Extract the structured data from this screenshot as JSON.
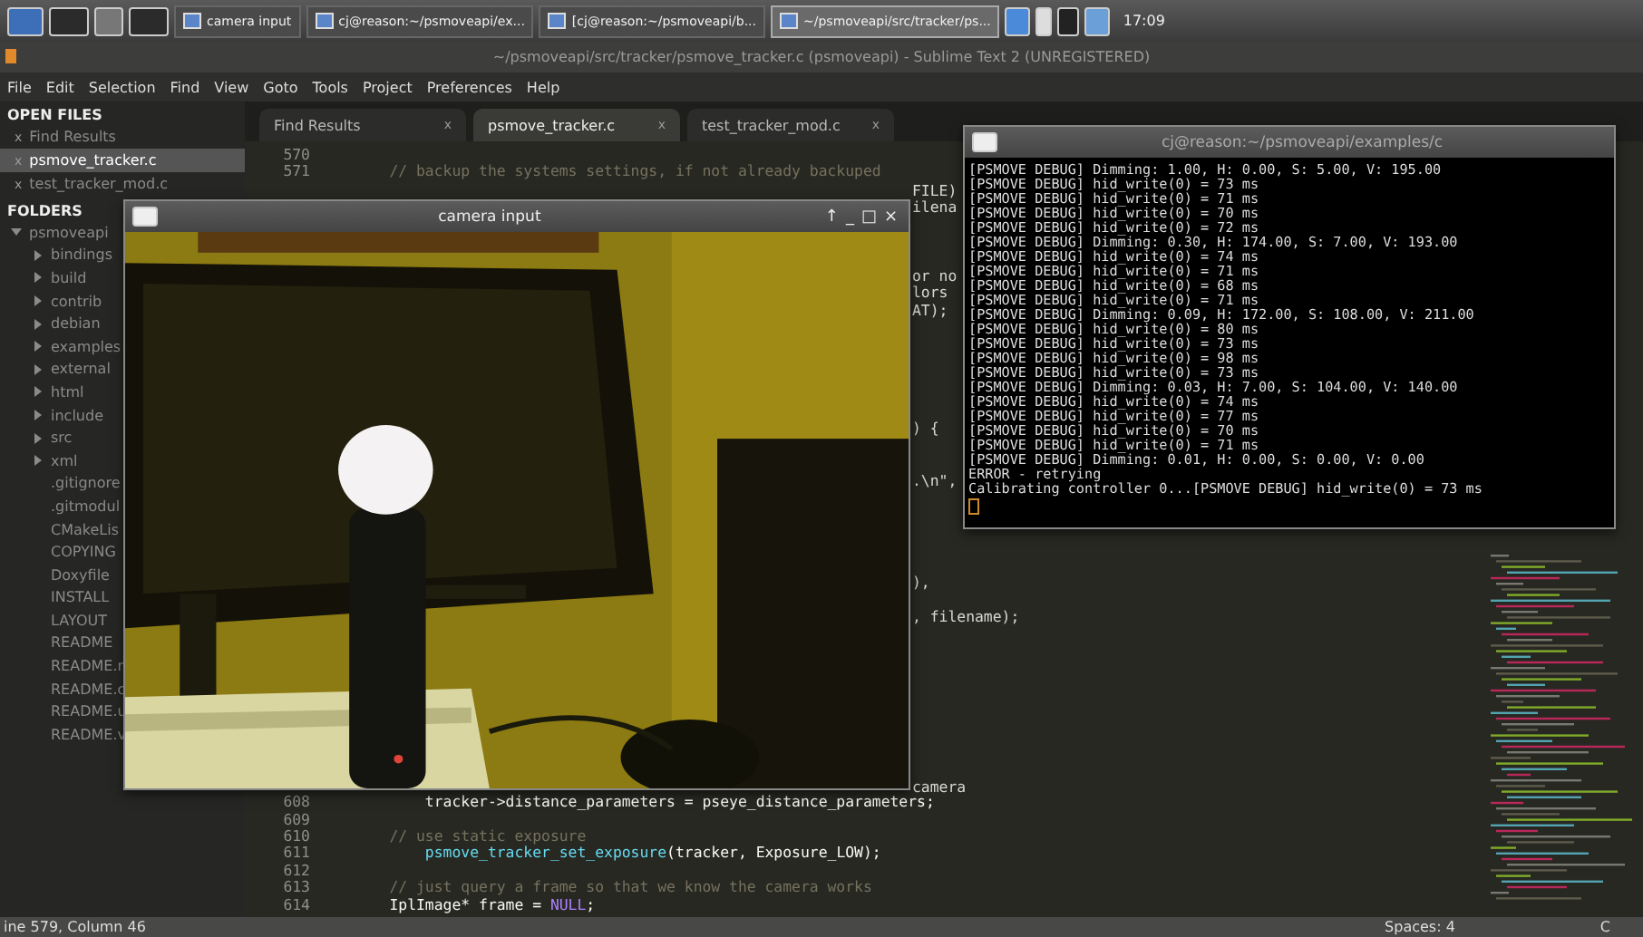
{
  "taskbar": {
    "tasks": [
      {
        "label": "camera input",
        "selected": false
      },
      {
        "label": "cj@reason:~/psmoveapi/ex...",
        "selected": false
      },
      {
        "label": "[cj@reason:~/psmoveapi/b...",
        "selected": false
      },
      {
        "label": "~/psmoveapi/src/tracker/ps...",
        "selected": true
      }
    ],
    "clock": "17:09"
  },
  "window": {
    "title": "~/psmoveapi/src/tracker/psmove_tracker.c (psmoveapi) - Sublime Text 2 (UNREGISTERED)"
  },
  "menu": [
    "File",
    "Edit",
    "Selection",
    "Find",
    "View",
    "Goto",
    "Tools",
    "Project",
    "Preferences",
    "Help"
  ],
  "sidebar": {
    "open_files_heading": "OPEN FILES",
    "open_files": [
      {
        "label": "Find Results",
        "close": "x",
        "selected": false
      },
      {
        "label": "psmove_tracker.c",
        "close": "x",
        "selected": true
      },
      {
        "label": "test_tracker_mod.c",
        "close": "x",
        "selected": false
      }
    ],
    "folders_heading": "FOLDERS",
    "folders": [
      {
        "label": "psmoveapi",
        "kind": "folder",
        "expanded": true,
        "children": [
          {
            "label": "bindings",
            "kind": "folder",
            "expanded": false
          },
          {
            "label": "build",
            "kind": "folder",
            "expanded": false
          },
          {
            "label": "contrib",
            "kind": "folder",
            "expanded": false
          },
          {
            "label": "debian",
            "kind": "folder",
            "expanded": false
          },
          {
            "label": "examples",
            "kind": "folder",
            "expanded": false
          },
          {
            "label": "external",
            "kind": "folder",
            "expanded": false
          },
          {
            "label": "html",
            "kind": "folder",
            "expanded": false
          },
          {
            "label": "include",
            "kind": "folder",
            "expanded": false
          },
          {
            "label": "src",
            "kind": "folder",
            "expanded": false
          },
          {
            "label": "xml",
            "kind": "folder",
            "expanded": false
          },
          {
            "label": ".gitignore",
            "kind": "file"
          },
          {
            "label": ".gitmodul",
            "kind": "file"
          },
          {
            "label": "CMakeLis",
            "kind": "file"
          },
          {
            "label": "COPYING",
            "kind": "file"
          },
          {
            "label": "Doxyfile",
            "kind": "file"
          },
          {
            "label": "INSTALL",
            "kind": "file"
          },
          {
            "label": "LAYOUT",
            "kind": "file"
          },
          {
            "label": "README",
            "kind": "file"
          },
          {
            "label": "README.r",
            "kind": "file"
          },
          {
            "label": "README.c",
            "kind": "file"
          },
          {
            "label": "README.u",
            "kind": "file"
          },
          {
            "label": "README.v",
            "kind": "file"
          }
        ]
      }
    ]
  },
  "tabs": [
    {
      "label": "Find Results",
      "close": "x",
      "selected": false
    },
    {
      "label": "psmove_tracker.c",
      "close": "x",
      "selected": true
    },
    {
      "label": "test_tracker_mod.c",
      "close": "x",
      "selected": false
    }
  ],
  "code_top": [
    {
      "number": "570"
    },
    {
      "number": "571",
      "tokens": [
        {
          "kind": "comment",
          "text": "    // backup the systems settings, if not already backuped"
        }
      ]
    }
  ],
  "code_fragments": [
    "FILE)",
    "ilena",
    "or no",
    "lors",
    "AT);",
    ") {",
    ".\\n\",",
    "),",
    ", filename);",
    "camera"
  ],
  "code_bottom": [
    {
      "number": "608",
      "tokens": [
        {
          "kind": "plain",
          "text": "        tracker->distance_parameters = pseye_distance_parameters;"
        }
      ]
    },
    {
      "number": "609"
    },
    {
      "number": "610",
      "tokens": [
        {
          "kind": "comment",
          "text": "    // use static exposure"
        }
      ]
    },
    {
      "number": "611",
      "tokens": [
        {
          "kind": "function",
          "text": "        psmove_tracker_set_exposure"
        },
        {
          "kind": "plain",
          "text": "(tracker, Exposure_LOW);"
        }
      ]
    },
    {
      "number": "612"
    },
    {
      "number": "613",
      "tokens": [
        {
          "kind": "comment",
          "text": "    // just query a frame so that we know the camera works"
        }
      ]
    },
    {
      "number": "614",
      "tokens": [
        {
          "kind": "plain",
          "text": "    IplImage* frame = "
        },
        {
          "kind": "constant",
          "text": "NULL"
        },
        {
          "kind": "plain",
          "text": ";"
        }
      ]
    }
  ],
  "camera_window": {
    "title": "camera input",
    "buttons": [
      "↑",
      "_",
      "□",
      "×"
    ]
  },
  "terminal": {
    "title": "cj@reason:~/psmoveapi/examples/c",
    "lines": [
      "[PSMOVE DEBUG] Dimming: 1.00, H: 0.00, S: 5.00, V: 195.00",
      "[PSMOVE DEBUG] hid_write(0) = 73 ms",
      "[PSMOVE DEBUG] hid_write(0) = 71 ms",
      "[PSMOVE DEBUG] hid_write(0) = 70 ms",
      "[PSMOVE DEBUG] hid_write(0) = 72 ms",
      "[PSMOVE DEBUG] Dimming: 0.30, H: 174.00, S: 7.00, V: 193.00",
      "[PSMOVE DEBUG] hid_write(0) = 74 ms",
      "[PSMOVE DEBUG] hid_write(0) = 71 ms",
      "[PSMOVE DEBUG] hid_write(0) = 68 ms",
      "[PSMOVE DEBUG] hid_write(0) = 71 ms",
      "[PSMOVE DEBUG] Dimming: 0.09, H: 172.00, S: 108.00, V: 211.00",
      "[PSMOVE DEBUG] hid_write(0) = 80 ms",
      "[PSMOVE DEBUG] hid_write(0) = 73 ms",
      "[PSMOVE DEBUG] hid_write(0) = 98 ms",
      "[PSMOVE DEBUG] hid_write(0) = 73 ms",
      "[PSMOVE DEBUG] Dimming: 0.03, H: 7.00, S: 104.00, V: 140.00",
      "[PSMOVE DEBUG] hid_write(0) = 74 ms",
      "[PSMOVE DEBUG] hid_write(0) = 77 ms",
      "[PSMOVE DEBUG] hid_write(0) = 70 ms",
      "[PSMOVE DEBUG] hid_write(0) = 71 ms",
      "[PSMOVE DEBUG] Dimming: 0.01, H: 0.00, S: 0.00, V: 0.00",
      "ERROR - retrying",
      "Calibrating controller 0...[PSMOVE DEBUG] hid_write(0) = 73 ms"
    ]
  },
  "status_bar": {
    "position": "ine 579, Column 46",
    "indentation": "Spaces: 4",
    "syntax": "C"
  }
}
